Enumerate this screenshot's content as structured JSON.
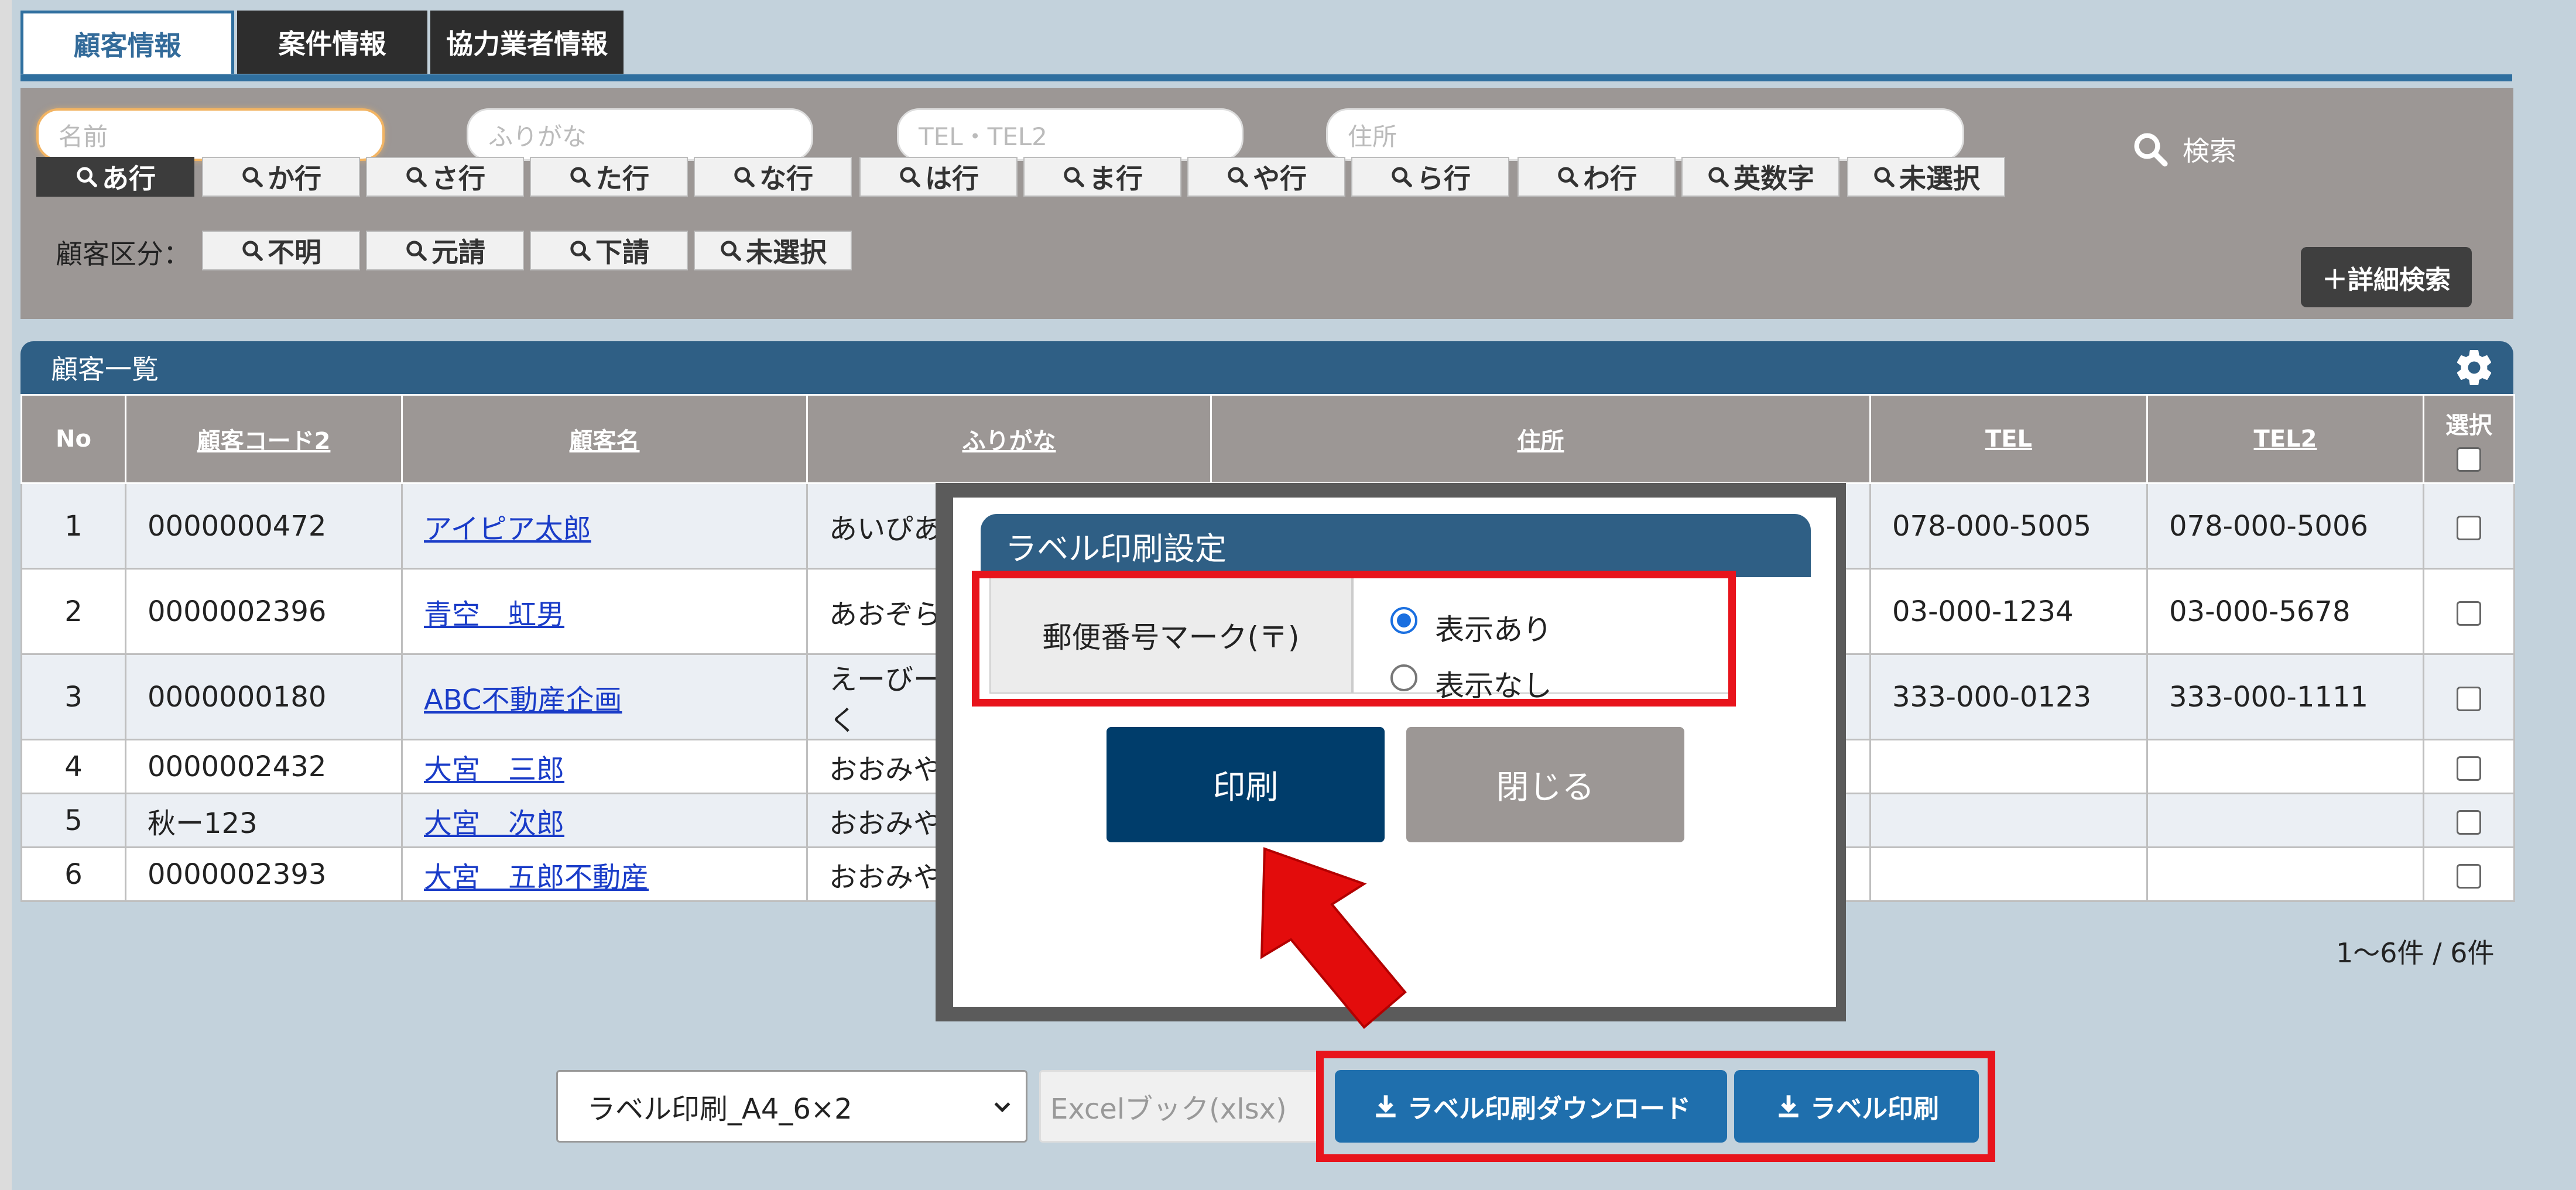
{
  "tabs": [
    {
      "label": "顧客情報",
      "active": true
    },
    {
      "label": "案件情報",
      "active": false
    },
    {
      "label": "協力業者情報",
      "active": false
    }
  ],
  "search": {
    "name_placeholder": "名前",
    "furigana_placeholder": "ふりがな",
    "tel_placeholder": "TEL・TEL2",
    "address_placeholder": "住所",
    "search_label": "検索"
  },
  "kana_filters": [
    "あ行",
    "か行",
    "さ行",
    "た行",
    "な行",
    "は行",
    "ま行",
    "や行",
    "ら行",
    "わ行",
    "英数字",
    "未選択"
  ],
  "category": {
    "label": "顧客区分：",
    "options": [
      "不明",
      "元請",
      "下請",
      "未選択"
    ]
  },
  "detail_search_label": "＋詳細検索",
  "list": {
    "title": "顧客一覧",
    "columns": [
      "No",
      "顧客コード2",
      "顧客名",
      "ふりがな",
      "住所",
      "TEL",
      "TEL2",
      "選択"
    ],
    "rows": [
      {
        "no": "1",
        "code": "0000000472",
        "name": "アイピア太郎",
        "kana": "あいぴあ",
        "tel": "078-000-5005",
        "tel2": "078-000-5006"
      },
      {
        "no": "2",
        "code": "0000002396",
        "name": "青空　虹男",
        "kana": "あおぞら",
        "tel": "03-000-1234",
        "tel2": "03-000-5678"
      },
      {
        "no": "3",
        "code": "0000000180",
        "name": "ABC不動産企画",
        "kana": "えーびー",
        "kana2": "く",
        "tel": "333-000-0123",
        "tel2": "333-000-1111"
      },
      {
        "no": "4",
        "code": "0000002432",
        "name": "大宮　三郎",
        "kana": "おおみや",
        "tel": "",
        "tel2": ""
      },
      {
        "no": "5",
        "code": "秋ー123",
        "name": "大宮　次郎",
        "kana": "おおみや",
        "tel": "",
        "tel2": ""
      },
      {
        "no": "6",
        "code": "0000002393",
        "name": "大宮　五郎不動産",
        "kana": "おおみや",
        "tel": "",
        "tel2": ""
      }
    ],
    "count_text": "1〜6件 / 6件"
  },
  "bottom": {
    "template_select": "ラベル印刷_A4_6×2",
    "format_select": "Excelブック(xlsx)",
    "download_label": "ラベル印刷ダウンロード",
    "print_label": "ラベル印刷"
  },
  "modal": {
    "title": "ラベル印刷設定",
    "option_label": "郵便番号マーク(〒)",
    "options": [
      "表示あり",
      "表示なし"
    ],
    "selected": "表示あり",
    "print_button": "印刷",
    "close_button": "閉じる"
  },
  "colors": {
    "accent": "#2f5f85",
    "primary_button": "#003d6b",
    "highlight": "#e8141c",
    "arrow": "#e30c0c"
  }
}
